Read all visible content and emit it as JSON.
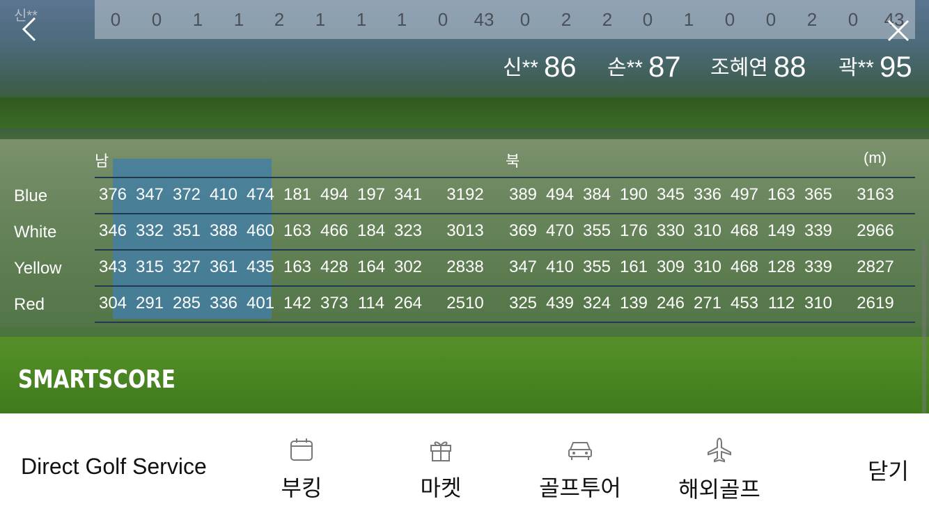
{
  "header": {
    "faded_name": "신**",
    "score_strip": [
      "0",
      "0",
      "1",
      "1",
      "2",
      "1",
      "1",
      "1",
      "0",
      "43",
      "0",
      "2",
      "2",
      "0",
      "1",
      "0",
      "0",
      "2",
      "0",
      "43"
    ],
    "back_icon": "chevron-left-icon",
    "close_icon": "close-x-icon"
  },
  "players": [
    {
      "name": "신**",
      "score": "86"
    },
    {
      "name": "손**",
      "score": "87"
    },
    {
      "name": "조혜연",
      "score": "88"
    },
    {
      "name": "곽**",
      "score": "95"
    }
  ],
  "distances": {
    "front_label": "남",
    "back_label": "북",
    "unit_label": "(m)",
    "rows": [
      {
        "tee": "Blue",
        "values": [
          "376",
          "347",
          "372",
          "410",
          "474",
          "181",
          "494",
          "197",
          "341",
          "3192",
          "389",
          "494",
          "384",
          "190",
          "345",
          "336",
          "497",
          "163",
          "365",
          "3163"
        ]
      },
      {
        "tee": "White",
        "values": [
          "346",
          "332",
          "351",
          "388",
          "460",
          "163",
          "466",
          "184",
          "323",
          "3013",
          "369",
          "470",
          "355",
          "176",
          "330",
          "310",
          "468",
          "149",
          "339",
          "2966"
        ]
      },
      {
        "tee": "Yellow",
        "values": [
          "343",
          "315",
          "327",
          "361",
          "435",
          "163",
          "428",
          "164",
          "302",
          "2838",
          "347",
          "410",
          "355",
          "161",
          "309",
          "310",
          "468",
          "128",
          "339",
          "2827"
        ]
      },
      {
        "tee": "Red",
        "values": [
          "304",
          "291",
          "285",
          "336",
          "401",
          "142",
          "373",
          "114",
          "264",
          "2510",
          "325",
          "439",
          "324",
          "139",
          "246",
          "271",
          "453",
          "112",
          "310",
          "2619"
        ]
      }
    ]
  },
  "brand": "SMARTSCORE",
  "bottom_bar": {
    "title": "Direct Golf Service",
    "items": [
      {
        "label": "부킹",
        "icon": "calendar-icon"
      },
      {
        "label": "마켓",
        "icon": "gift-icon"
      },
      {
        "label": "골프투어",
        "icon": "car-icon"
      },
      {
        "label": "해외골프",
        "icon": "airplane-icon"
      }
    ],
    "close_label": "닫기"
  }
}
